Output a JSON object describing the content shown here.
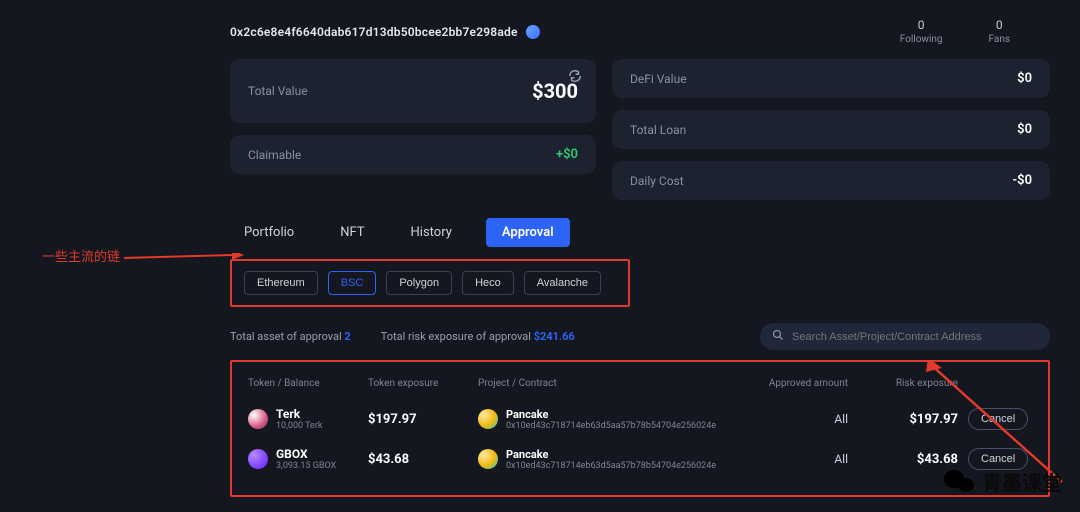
{
  "header": {
    "address": "0x2c6e8e4f6640dab617d13db50bcee2bb7e298ade",
    "following_count": "0",
    "following_label": "Following",
    "fans_count": "0",
    "fans_label": "Fans"
  },
  "stats": {
    "total_value_label": "Total Value",
    "total_value": "$300",
    "claimable_label": "Claimable",
    "claimable_value": "+$0",
    "defi_value_label": "DeFi Value",
    "defi_value": "$0",
    "total_loan_label": "Total Loan",
    "total_loan": "$0",
    "daily_cost_label": "Daily Cost",
    "daily_cost": "-$0"
  },
  "tabs": {
    "items": [
      "Portfolio",
      "NFT",
      "History",
      "Approval"
    ],
    "active": "Approval"
  },
  "chains": {
    "items": [
      "Ethereum",
      "BSC",
      "Polygon",
      "Heco",
      "Avalanche"
    ],
    "selected": "BSC"
  },
  "annotation_left": "一些主流的链",
  "summary": {
    "total_asset_label": "Total asset of approval",
    "total_asset_value": "2",
    "risk_exposure_label": "Total risk exposure of approval",
    "risk_exposure_value": "$241.66"
  },
  "search": {
    "placeholder": "Search Asset/Project/Contract Address"
  },
  "table": {
    "headers": {
      "token": "Token / Balance",
      "exposure": "Token exposure",
      "project": "Project / Contract",
      "approved": "Approved amount",
      "risk": "Risk exposure"
    },
    "rows": [
      {
        "token_name": "Terk",
        "token_balance": "10,000 Terk",
        "token_exposure": "$197.97",
        "project_name": "Pancake",
        "project_address": "0x10ed43c718714eb63d5aa57b78b54704e256024e",
        "approved_amount": "All",
        "risk_exposure": "$197.97",
        "cancel_label": "Cancel"
      },
      {
        "token_name": "GBOX",
        "token_balance": "3,093.15 GBOX",
        "token_exposure": "$43.68",
        "project_name": "Pancake",
        "project_address": "0x10ed43c718714eb63d5aa57b78b54704e256024e",
        "approved_amount": "All",
        "risk_exposure": "$43.68",
        "cancel_label": "Cancel"
      }
    ]
  },
  "watermark": "青墨课堂"
}
